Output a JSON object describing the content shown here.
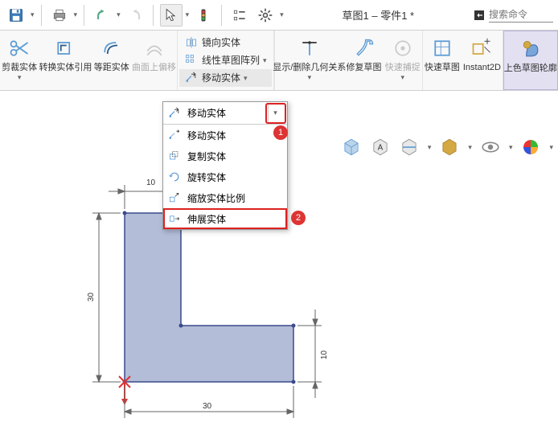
{
  "title": "草图1 – 零件1 *",
  "search_placeholder": "搜索命令",
  "ribbon": {
    "trim": "剪裁实体",
    "convert": "转换实体引用",
    "offset": "等距实体",
    "surface_offset": "曲面上偏移",
    "mirror": "镜向实体",
    "pattern": "线性草图阵列",
    "move_header": "移动实体",
    "display_rel": "显示/删除几何关系",
    "repair": "修复草图",
    "snap": "快速捕捉",
    "rapid": "快速草图",
    "instant": "Instant2D",
    "shade": "上色草图轮廓"
  },
  "dropdown": {
    "header": "移动实体",
    "items": [
      "移动实体",
      "复制实体",
      "旋转实体",
      "缩放实体比例",
      "伸展实体"
    ]
  },
  "dims": {
    "w": "30",
    "h": "30",
    "t1": "10",
    "t2": "10"
  }
}
